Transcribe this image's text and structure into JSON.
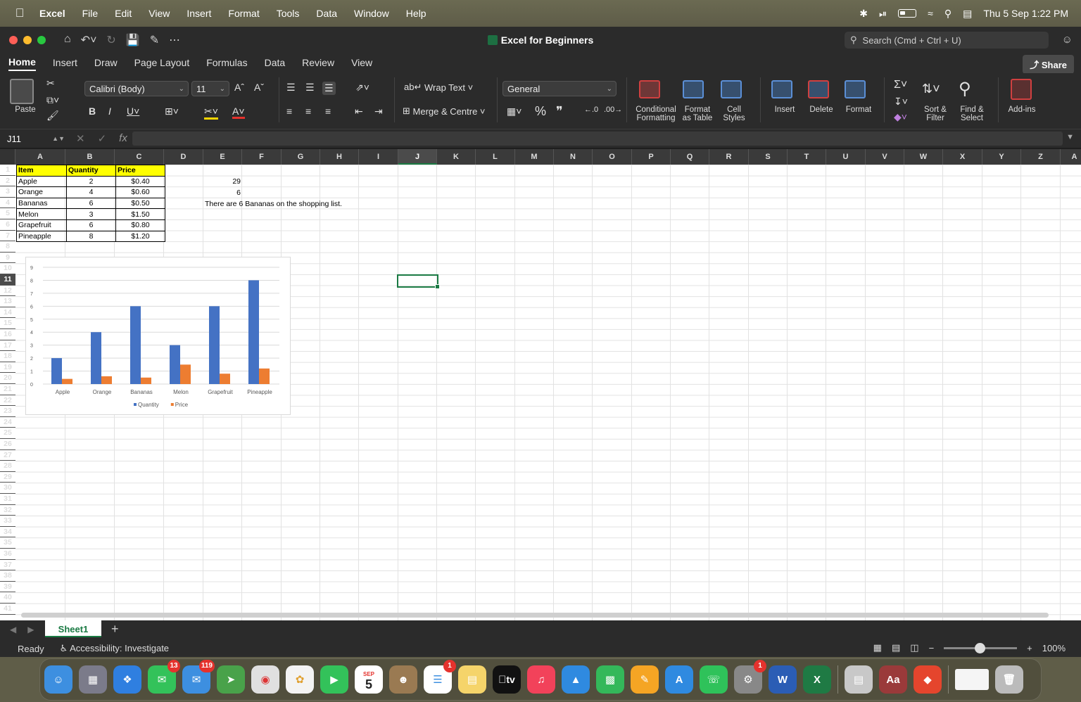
{
  "menubar": {
    "app": "Excel",
    "items": [
      "File",
      "Edit",
      "View",
      "Insert",
      "Format",
      "Tools",
      "Data",
      "Window",
      "Help"
    ],
    "clock": "Thu 5 Sep  1:22 PM"
  },
  "window": {
    "title": "Excel for Beginners",
    "search_placeholder": "Search (Cmd + Ctrl + U)"
  },
  "ribbon_tabs": [
    "Home",
    "Insert",
    "Draw",
    "Page Layout",
    "Formulas",
    "Data",
    "Review",
    "View"
  ],
  "share_label": "Share",
  "ribbon": {
    "paste": "Paste",
    "font_name": "Calibri (Body)",
    "font_size": "11",
    "wrap_text": "Wrap Text",
    "merge_centre": "Merge & Centre",
    "number_format": "General",
    "conditional_formatting": [
      "Conditional",
      "Formatting"
    ],
    "format_as_table": [
      "Format",
      "as Table"
    ],
    "cell_styles": [
      "Cell",
      "Styles"
    ],
    "insert": "Insert",
    "delete": "Delete",
    "format": "Format",
    "sort_filter": [
      "Sort &",
      "Filter"
    ],
    "find_select": [
      "Find &",
      "Select"
    ],
    "addins": "Add-ins"
  },
  "formula_bar": {
    "name_box": "J11",
    "formula": ""
  },
  "columns": [
    "A",
    "B",
    "C",
    "D",
    "E",
    "F",
    "G",
    "H",
    "I",
    "J",
    "K",
    "L",
    "M",
    "N",
    "O",
    "P",
    "Q",
    "R",
    "S",
    "T",
    "U",
    "V",
    "W",
    "X",
    "Y",
    "Z",
    "A"
  ],
  "selected_column": "J",
  "selected_row": "11",
  "rows_count": 41,
  "table": {
    "headers": [
      "Item",
      "Quantity",
      "Price"
    ],
    "rows": [
      [
        "Apple",
        "2",
        "$0.40"
      ],
      [
        "Orange",
        "4",
        "$0.60"
      ],
      [
        "Bananas",
        "6",
        "$0.50"
      ],
      [
        "Melon",
        "3",
        "$1.50"
      ],
      [
        "Grapefruit",
        "6",
        "$0.80"
      ],
      [
        "Pineapple",
        "8",
        "$1.20"
      ]
    ]
  },
  "cells": {
    "e2": "29",
    "e3": "6",
    "e4": "There are 6 Bananas on the shopping list."
  },
  "chart_data": {
    "type": "bar",
    "categories": [
      "Apple",
      "Orange",
      "Bananas",
      "Melon",
      "Grapefruit",
      "Pineapple"
    ],
    "series": [
      {
        "name": "Quantity",
        "values": [
          2,
          4,
          6,
          3,
          6,
          8
        ],
        "color": "#4472c4"
      },
      {
        "name": "Price",
        "values": [
          0.4,
          0.6,
          0.5,
          1.5,
          0.8,
          1.2
        ],
        "color": "#ed7d31"
      }
    ],
    "ylim": [
      0,
      9
    ],
    "yticks": [
      "0",
      "1",
      "2",
      "3",
      "4",
      "5",
      "6",
      "7",
      "8",
      "9"
    ],
    "grid": true,
    "legend": "bottom"
  },
  "sheet_tab": "Sheet1",
  "status": {
    "ready": "Ready",
    "accessibility": "Accessibility: Investigate",
    "zoom": "100%"
  },
  "dock": {
    "messages_badge": "13",
    "mail_badge": "119",
    "calendar_month": "SEP",
    "calendar_day": "5",
    "reminders_badge": "1",
    "settings_badge": "1",
    "tv_label": "tv",
    "dictionary_label": "Aa"
  }
}
